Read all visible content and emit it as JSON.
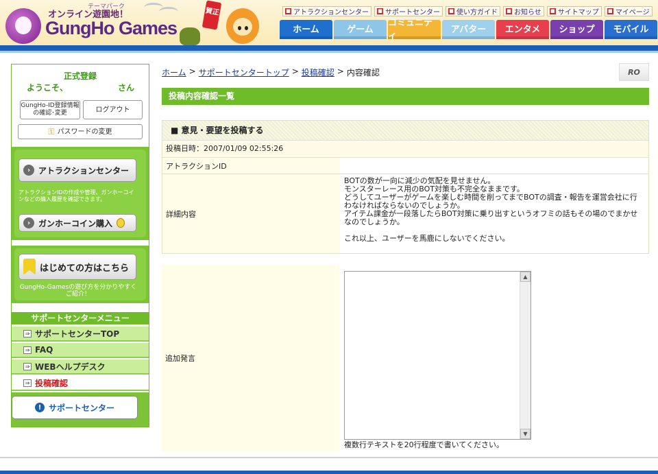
{
  "header": {
    "tagline_small": "テーマパーク",
    "tagline": "オンライン遊園地！",
    "logo": "GungHo Games",
    "newyear_badge": "賀正",
    "top_links": [
      "アトラクションセンター",
      "サポートセンター",
      "使い方ガイド",
      "お知らせ",
      "サイトマップ",
      "マイページ"
    ],
    "nav_tabs": [
      {
        "label": "ホーム",
        "color": "#1f6fcf"
      },
      {
        "label": "ゲーム",
        "color": "#8ec6ea"
      },
      {
        "label": "コミュニティ",
        "color": "#f5b636"
      },
      {
        "label": "アバター",
        "color": "#9fd0ee"
      },
      {
        "label": "エンタメ",
        "color": "#e83f4e"
      },
      {
        "label": "ショップ",
        "color": "#7a3fae"
      },
      {
        "label": "モバイル",
        "color": "#2a6fd0"
      }
    ]
  },
  "sidebar": {
    "reg_label": "正式登録",
    "welcome": "ようこそ、",
    "san": "さん",
    "gungho_id_btn": "GungHo-ID登録情報の確認･変更",
    "logout_btn": "ログアウト",
    "password_btn": "パスワードの変更",
    "attraction_btn": "アトラクションセンター",
    "attraction_desc": "アトラクションIDの作成や管理、ガンホーコインなどの購入履歴を確認できます。",
    "coin_btn": "ガンホーコイン購入",
    "beginner_btn": "はじめての方はこちら",
    "beginner_desc": "GungHo-Gamesの遊び方を分かりやすくご紹介！",
    "menu_header": "サポートセンターメニュー",
    "menu_items": [
      "サポートセンターTOP",
      "FAQ",
      "WEBヘルプデスク",
      "投稿確認"
    ],
    "support_btn": "サポートセンター"
  },
  "breadcrumb": {
    "home": "ホーム",
    "sep1": ">",
    "support_top": "サポートセンタートップ",
    "sep2": ">",
    "post_check": "投稿確認",
    "sep3": ">",
    "current": "内容確認"
  },
  "rok_logo": "RO",
  "section_title": "投稿内容確認一覧",
  "post": {
    "title": "■ 意見・要望を投稿する",
    "date": "投稿日時：2007/01/09 02:55:26",
    "attraction_id_label": "アトラクションID",
    "attraction_id_value": "",
    "detail_label": "詳細内容",
    "detail_lines": [
      "BOTの数が一向に減少の気配を見せません。",
      "モンスターレース用のBOT対策も不完全なままです。",
      "どうしてユーザーがゲームを楽しむ時間を削ってまでBOTの調査・報告を運営会社に行わなければならないのでしょうか。",
      "アイテム課金が一段落したらBOT対策に乗り出すというオフミの話もその場のでまかせなのでしょうか。",
      "",
      "これ以上、ユーザーを馬鹿にしないでください。"
    ],
    "add_label": "追加発言",
    "add_hint": "複数行テキストを20行程度で書いてください。"
  }
}
